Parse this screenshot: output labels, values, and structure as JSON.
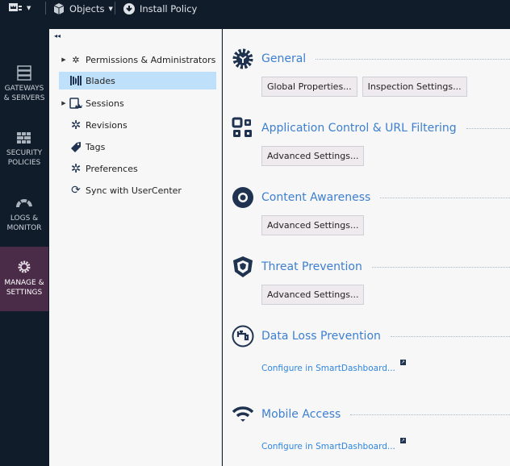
{
  "toolbar": {
    "objects": "Objects",
    "install_policy": "Install Policy"
  },
  "leftnav": [
    {
      "line1": "GATEWAYS",
      "line2": "& SERVERS"
    },
    {
      "line1": "SECURITY",
      "line2": "POLICIES"
    },
    {
      "line1": "LOGS &",
      "line2": "MONITOR"
    },
    {
      "line1": "MANAGE &",
      "line2": "SETTINGS"
    }
  ],
  "tree": [
    "Permissions & Administrators",
    "Blades",
    "Sessions",
    "Revisions",
    "Tags",
    "Preferences",
    "Sync with UserCenter"
  ],
  "sections": {
    "general": {
      "title": "General",
      "b1": "Global Properties...",
      "b2": "Inspection Settings..."
    },
    "appctl": {
      "title": "Application Control & URL Filtering",
      "b1": "Advanced Settings..."
    },
    "content": {
      "title": "Content Awareness",
      "b1": "Advanced Settings..."
    },
    "threat": {
      "title": "Threat Prevention",
      "b1": "Advanced Settings..."
    },
    "dlp": {
      "title": "Data Loss Prevention",
      "link": "Configure in SmartDashboard..."
    },
    "mobile": {
      "title": "Mobile Access",
      "link": "Configure in SmartDashboard..."
    }
  },
  "colors": {
    "accent": "#3d7fcf",
    "active_nav": "#4a2b48",
    "selected": "#bfe0fa"
  }
}
